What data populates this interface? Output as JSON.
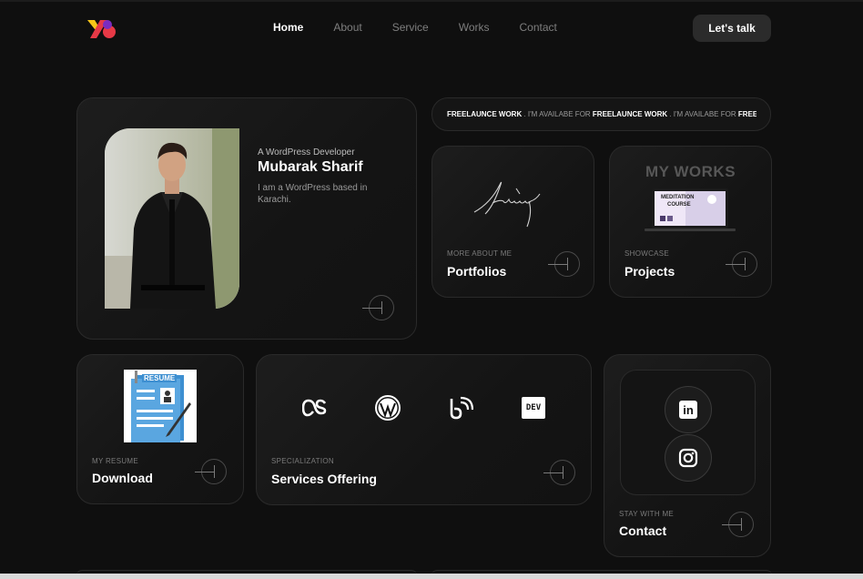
{
  "nav": {
    "logo_name": "logo-icon",
    "links": [
      {
        "label": "Home",
        "active": true
      },
      {
        "label": "About",
        "active": false
      },
      {
        "label": "Service",
        "active": false
      },
      {
        "label": "Works",
        "active": false
      },
      {
        "label": "Contact",
        "active": false
      }
    ],
    "cta_label": "Let's talk"
  },
  "profile": {
    "subtitle": "A WordPress Developer",
    "name": "Mubarak Sharif",
    "bio": "I am a WordPress based in Karachi."
  },
  "marquee": {
    "segments": [
      {
        "text": "FREELAUNCE WORK",
        "bold": true
      },
      {
        "text": " . I'M AVAILABE FOR ",
        "bold": false
      },
      {
        "text": "FREELAUNCE WORK",
        "bold": true
      },
      {
        "text": " . I'M AVAILABE FOR ",
        "bold": false
      },
      {
        "text": "FREEL",
        "bold": true
      }
    ]
  },
  "portfolios": {
    "label": "MORE ABOUT ME",
    "title": "Portfolios"
  },
  "projects": {
    "label": "SHOWCASE",
    "title": "Projects",
    "bg_text": "MY WORKS",
    "laptop_line1": "MEDITATION",
    "laptop_line2": "COURSE"
  },
  "resume": {
    "label": "MY RESUME",
    "title": "Download",
    "image_text": "RESUME"
  },
  "services": {
    "label": "SPECIALIZATION",
    "title": "Services Offering",
    "icons": [
      "lastfm-icon",
      "wordpress-icon",
      "blogger-icon",
      "dev-icon"
    ],
    "dev_text": "DEV"
  },
  "contact": {
    "label": "STAY WITH ME",
    "title": "Contact",
    "social_icons": [
      "linkedin-icon",
      "instagram-icon"
    ],
    "linkedin_text": "in"
  },
  "colors": {
    "background": "#0f0f0f",
    "card": "#181818",
    "border": "#2a2a2a",
    "muted": "#7a7a7a"
  }
}
